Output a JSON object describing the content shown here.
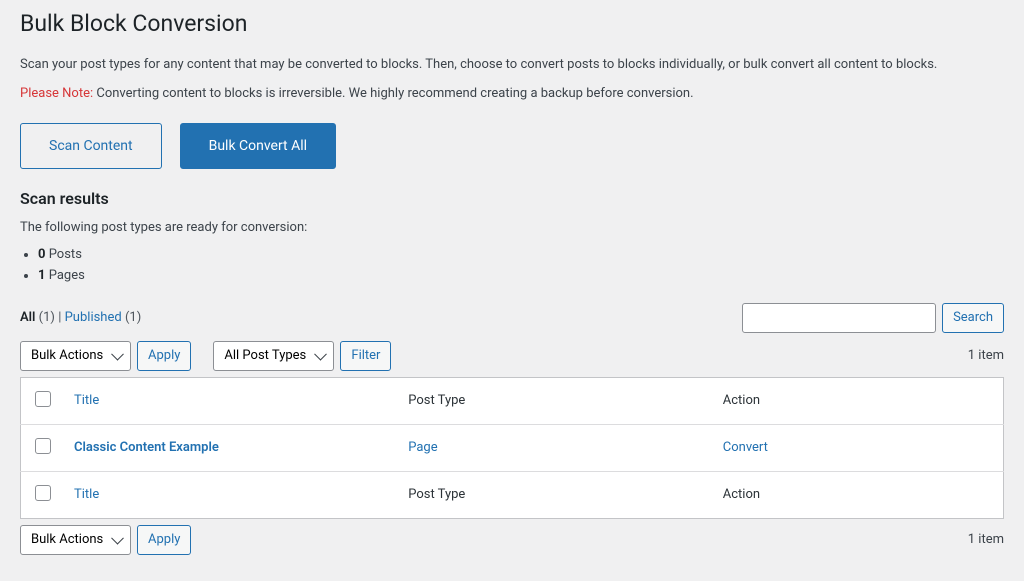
{
  "page": {
    "title": "Bulk Block Conversion",
    "intro": "Scan your post types for any content that may be converted to blocks. Then, choose to convert posts to blocks individually, or bulk convert all content to blocks.",
    "note_label": "Please Note:",
    "note_text": " Converting content to blocks is irreversible. We highly recommend creating a backup before conversion."
  },
  "buttons": {
    "scan": "Scan Content",
    "bulk_convert": "Bulk Convert All",
    "apply": "Apply",
    "filter": "Filter",
    "search": "Search"
  },
  "scan_results": {
    "heading": "Scan results",
    "ready_text": "The following post types are ready for conversion:",
    "counts": [
      {
        "n": "0",
        "label": " Posts"
      },
      {
        "n": "1",
        "label": " Pages"
      }
    ]
  },
  "filters": {
    "all_label": "All",
    "all_count": "(1)",
    "sep": " | ",
    "published_label": "Published",
    "published_count": " (1)"
  },
  "selects": {
    "bulk_actions": "Bulk Actions",
    "all_post_types": "All Post Types"
  },
  "pagination": {
    "items": "1 item"
  },
  "table": {
    "columns": {
      "title": "Title",
      "post_type": "Post Type",
      "action": "Action"
    },
    "rows": [
      {
        "title": "Classic Content Example",
        "post_type": "Page",
        "action": "Convert"
      }
    ]
  }
}
